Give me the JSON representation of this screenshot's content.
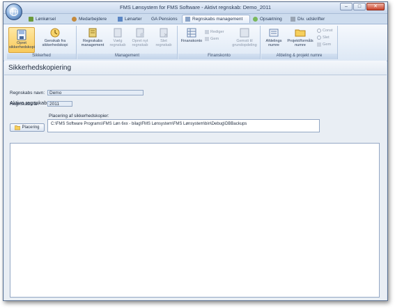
{
  "window": {
    "title": "FMS Lønsystem for FMS Software - Aktivt regnskab: Demo_2011",
    "controls": {
      "minimize": "–",
      "maximize": "□",
      "close": "✕"
    }
  },
  "tabs": [
    {
      "label": "Lønkørsel",
      "icon": "payroll-icon"
    },
    {
      "label": "Medarbejdere",
      "icon": "employees-icon"
    },
    {
      "label": "Lønarter",
      "icon": "wage-types-icon"
    },
    {
      "label": "GA Pensions",
      "icon": "pension-icon"
    },
    {
      "label": "Regnskabs management",
      "icon": "accounting-icon",
      "active": true
    },
    {
      "label": "Opsætning",
      "icon": "settings-icon"
    },
    {
      "label": "Div. udskrifter",
      "icon": "printer-icon"
    }
  ],
  "ribbon": {
    "groups": [
      {
        "label": "Sikkerhed",
        "buttons": [
          {
            "label": "Opret sikkerhedskopi",
            "active": true
          },
          {
            "label": "Genskab fra sikkerhedskopi"
          }
        ]
      },
      {
        "label": "Management",
        "buttons": [
          {
            "label": "Regnskabs management"
          },
          {
            "label": "Vælg regnskab",
            "disabled": true
          },
          {
            "label": "Opret nyt regnskab",
            "disabled": true
          },
          {
            "label": "Slet regnskab",
            "disabled": true
          }
        ]
      },
      {
        "label": "Finanskonto",
        "buttons": [
          {
            "label": "Finanskonto"
          },
          {
            "label": "Gemsti til grundopdeling",
            "disabled": true
          }
        ],
        "small": [
          "Rediger",
          "Gem"
        ]
      },
      {
        "label": "Afdeling & projekt numre",
        "buttons": [
          {
            "label": "Afdelings numre"
          },
          {
            "label": "Projekt/formåls numre"
          }
        ],
        "small": [
          "Const",
          "Slet",
          "Gem"
        ]
      }
    ]
  },
  "page": {
    "title": "Sikkerhedskopiering",
    "section_title": "Aktive regnskab",
    "fields": {
      "regnskabs_navn_label": "Regnskabs navn:",
      "regnskabs_navn_value": "Demo",
      "regnskabs_aar_label": "Regnskabs år:",
      "regnskabs_aar_value": "2011"
    },
    "backup": {
      "location_label": "Placering af sikkerhedskopier:",
      "path": "C:\\FMS Software Programs\\FMS Løn 6xx - bilag\\FMS Lønsystem\\FMS Lønsystem\\bin\\Debug\\DBBackups",
      "button_label": "Placering"
    }
  },
  "colors": {
    "accent": "#f8c95a",
    "frame": "#d6e3f2",
    "content_bg": "#e9eef4",
    "close_red": "#c8412a"
  }
}
